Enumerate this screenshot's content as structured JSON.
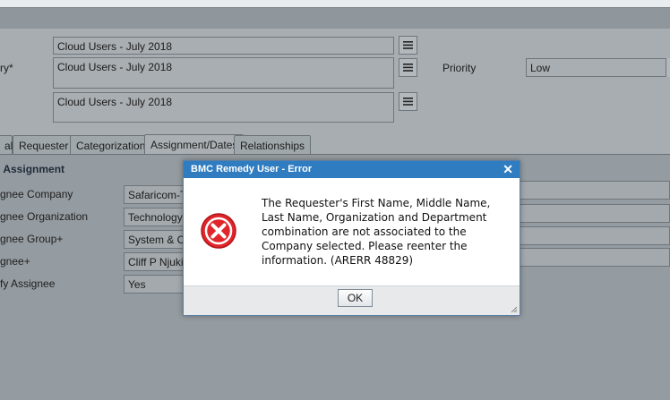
{
  "form": {
    "field1_value": "Cloud Users - July 2018",
    "summary_label": "ry*",
    "field2_value": "Cloud Users - July 2018",
    "field3_value": "Cloud Users - July 2018",
    "priority_label": "Priority",
    "priority_value": "Low"
  },
  "tabs": [
    {
      "label": "al"
    },
    {
      "label": "Requester"
    },
    {
      "label": "Categorization"
    },
    {
      "label": "Assignment/Dates"
    },
    {
      "label": "Relationships"
    }
  ],
  "active_tab": "Assignment/Dates",
  "assignment": {
    "section_title": "Assignment",
    "rows": [
      {
        "label": "gnee Company",
        "value": "Safaricom-Te"
      },
      {
        "label": "gnee Organization",
        "value": "Technology /"
      },
      {
        "label": "gnee Group+",
        "value": "System & Clo"
      },
      {
        "label": "gnee+",
        "value": "Cliff P Njukia"
      },
      {
        "label": "fy Assignee",
        "value": "Yes"
      }
    ]
  },
  "dialog": {
    "title": "BMC Remedy User - Error",
    "close_glyph": "✕",
    "message": "The Requester's First Name, Middle Name, Last Name, Organization and Department combination are not associated to the Company selected. Please reenter the information. (ARERR 48829)",
    "ok_label": "OK"
  },
  "colors": {
    "dialog_header": "#2f7cc1",
    "error_icon": "#e0262b"
  }
}
